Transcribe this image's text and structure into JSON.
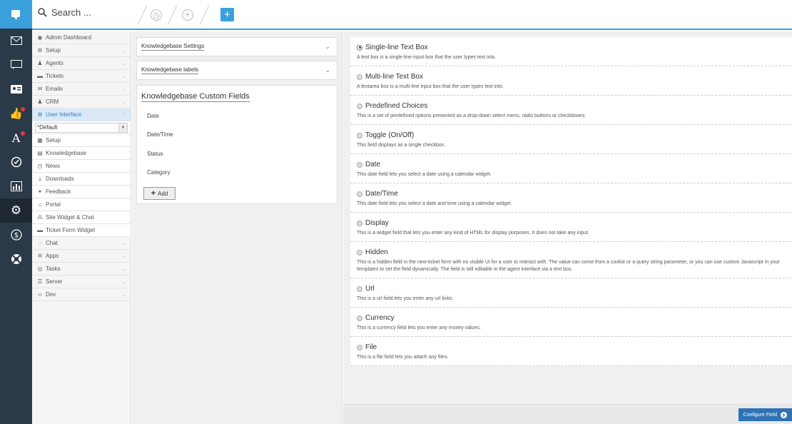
{
  "search": {
    "placeholder": "Search ..."
  },
  "rail": {
    "items": [
      {
        "icon": "mail-icon"
      },
      {
        "icon": "chat-icon"
      },
      {
        "icon": "contact-card-icon"
      },
      {
        "icon": "thumbs-up-icon"
      },
      {
        "icon": "font-icon"
      },
      {
        "icon": "check-circle-icon"
      },
      {
        "icon": "bar-chart-icon"
      },
      {
        "icon": "gear-icon"
      },
      {
        "icon": "dollar-icon"
      },
      {
        "icon": "lifebuoy-icon"
      }
    ]
  },
  "sidebar": {
    "admin_dashboard": "Admin Dashboard",
    "setup": "Setup",
    "agents": "Agents",
    "tickets": "Tickets",
    "emails": "Emails",
    "crm": "CRM",
    "user_interface": "User Interface",
    "select_value": "*Default",
    "ui_setup": "Setup",
    "knowledgebase": "Knowledgebase",
    "news": "News",
    "downloads": "Downloads",
    "feedback": "Feedback",
    "portal": "Portal",
    "site_widget": "Site Widget & Chat",
    "ticket_form_widget": "Ticket Form Widget",
    "chat": "Chat",
    "apps": "Apps",
    "tasks": "Tasks",
    "server": "Server",
    "dev": "Dev"
  },
  "middle": {
    "settings": "Knowledgebase Settings",
    "labels": "Knowledgebase labels",
    "custom_title": "Knowledgebase Custom Fields",
    "fields": [
      "Date",
      "Date/Time",
      "Status",
      "Category"
    ],
    "add_label": "Add"
  },
  "types": [
    {
      "name": "Single-line Text Box",
      "desc": "A text box is a single-line input box that the user types text into."
    },
    {
      "name": "Multi-line Text Box",
      "desc": "A textarea box is a multi-line input box that the user types text into."
    },
    {
      "name": "Predefined Choices",
      "desc": "This is a set of predefined options presented as a drop-down select menu, radio buttons or checkboxes."
    },
    {
      "name": "Toggle (On/Off)",
      "desc": "This field displays as a single checkbox."
    },
    {
      "name": "Date",
      "desc": "This date field lets you select a date using a calendar widget."
    },
    {
      "name": "Date/Time",
      "desc": "This date field lets you select a date and time using a calendar widget."
    },
    {
      "name": "Display",
      "desc": "This is a widget field that lets you enter any kind of HTML for display purposes. It does not take any input."
    },
    {
      "name": "Hidden",
      "desc": "This is a hidden field in the new-ticket form with no visible UI for a user to interact with. The value can come from a cookie or a query string parameter, or you can use custom Javascript in your templates to set the field dynamically. The field is still editable in the agent interface via a text box."
    },
    {
      "name": "Url",
      "desc": "This is a url field lets you enter any url links."
    },
    {
      "name": "Currency",
      "desc": "This is a currency field lets you enter any money values."
    },
    {
      "name": "File",
      "desc": "This is a file field lets you attach any files."
    }
  ],
  "configure_label": "Configure Field",
  "colors": {
    "accent": "#3aa0db",
    "rail": "#2b3a48",
    "primary_button": "#2f73b4"
  }
}
